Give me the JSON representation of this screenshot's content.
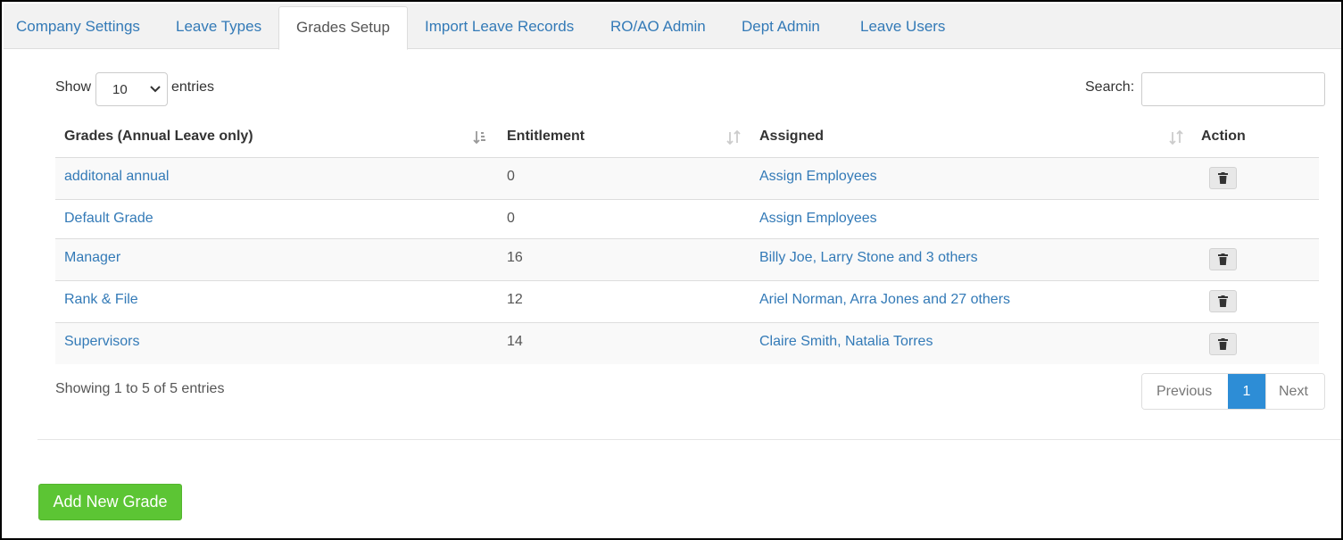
{
  "tabs": [
    {
      "label": "Company Settings",
      "active": false
    },
    {
      "label": "Leave Types",
      "active": false
    },
    {
      "label": "Grades Setup",
      "active": true
    },
    {
      "label": "Import Leave Records",
      "active": false
    },
    {
      "label": "RO/AO Admin",
      "active": false
    },
    {
      "label": "Dept Admin",
      "active": false
    },
    {
      "label": "Leave Users",
      "active": false
    }
  ],
  "controls": {
    "show_label": "Show",
    "page_length": "10",
    "entries_label": "entries",
    "search_label": "Search:",
    "search_value": ""
  },
  "table": {
    "columns": [
      "Grades (Annual Leave only)",
      "Entitlement",
      "Assigned",
      "Action"
    ],
    "rows": [
      {
        "grade": "additonal annual",
        "entitlement": "0",
        "assigned": "Assign Employees",
        "deletable": true
      },
      {
        "grade": "Default Grade",
        "entitlement": "0",
        "assigned": "Assign Employees",
        "deletable": false
      },
      {
        "grade": "Manager",
        "entitlement": "16",
        "assigned": "Billy Joe, Larry Stone and 3 others",
        "deletable": true
      },
      {
        "grade": "Rank & File",
        "entitlement": "12",
        "assigned": "Ariel Norman, Arra Jones and 27 others",
        "deletable": true
      },
      {
        "grade": "Supervisors",
        "entitlement": "14",
        "assigned": "Claire Smith, Natalia Torres",
        "deletable": true
      }
    ]
  },
  "footer": {
    "info": "Showing 1 to 5 of 5 entries",
    "previous": "Previous",
    "current_page": "1",
    "next": "Next"
  },
  "add_button": "Add New Grade",
  "icons": {
    "delete": "trash-icon",
    "sort_active": "sort-ascending-icon",
    "sort": "sort-both-icon",
    "select": "chevron-down-icon"
  },
  "colors": {
    "link": "#337ab7",
    "active_page": "#2d8dd6",
    "add_button": "#5cc534"
  }
}
